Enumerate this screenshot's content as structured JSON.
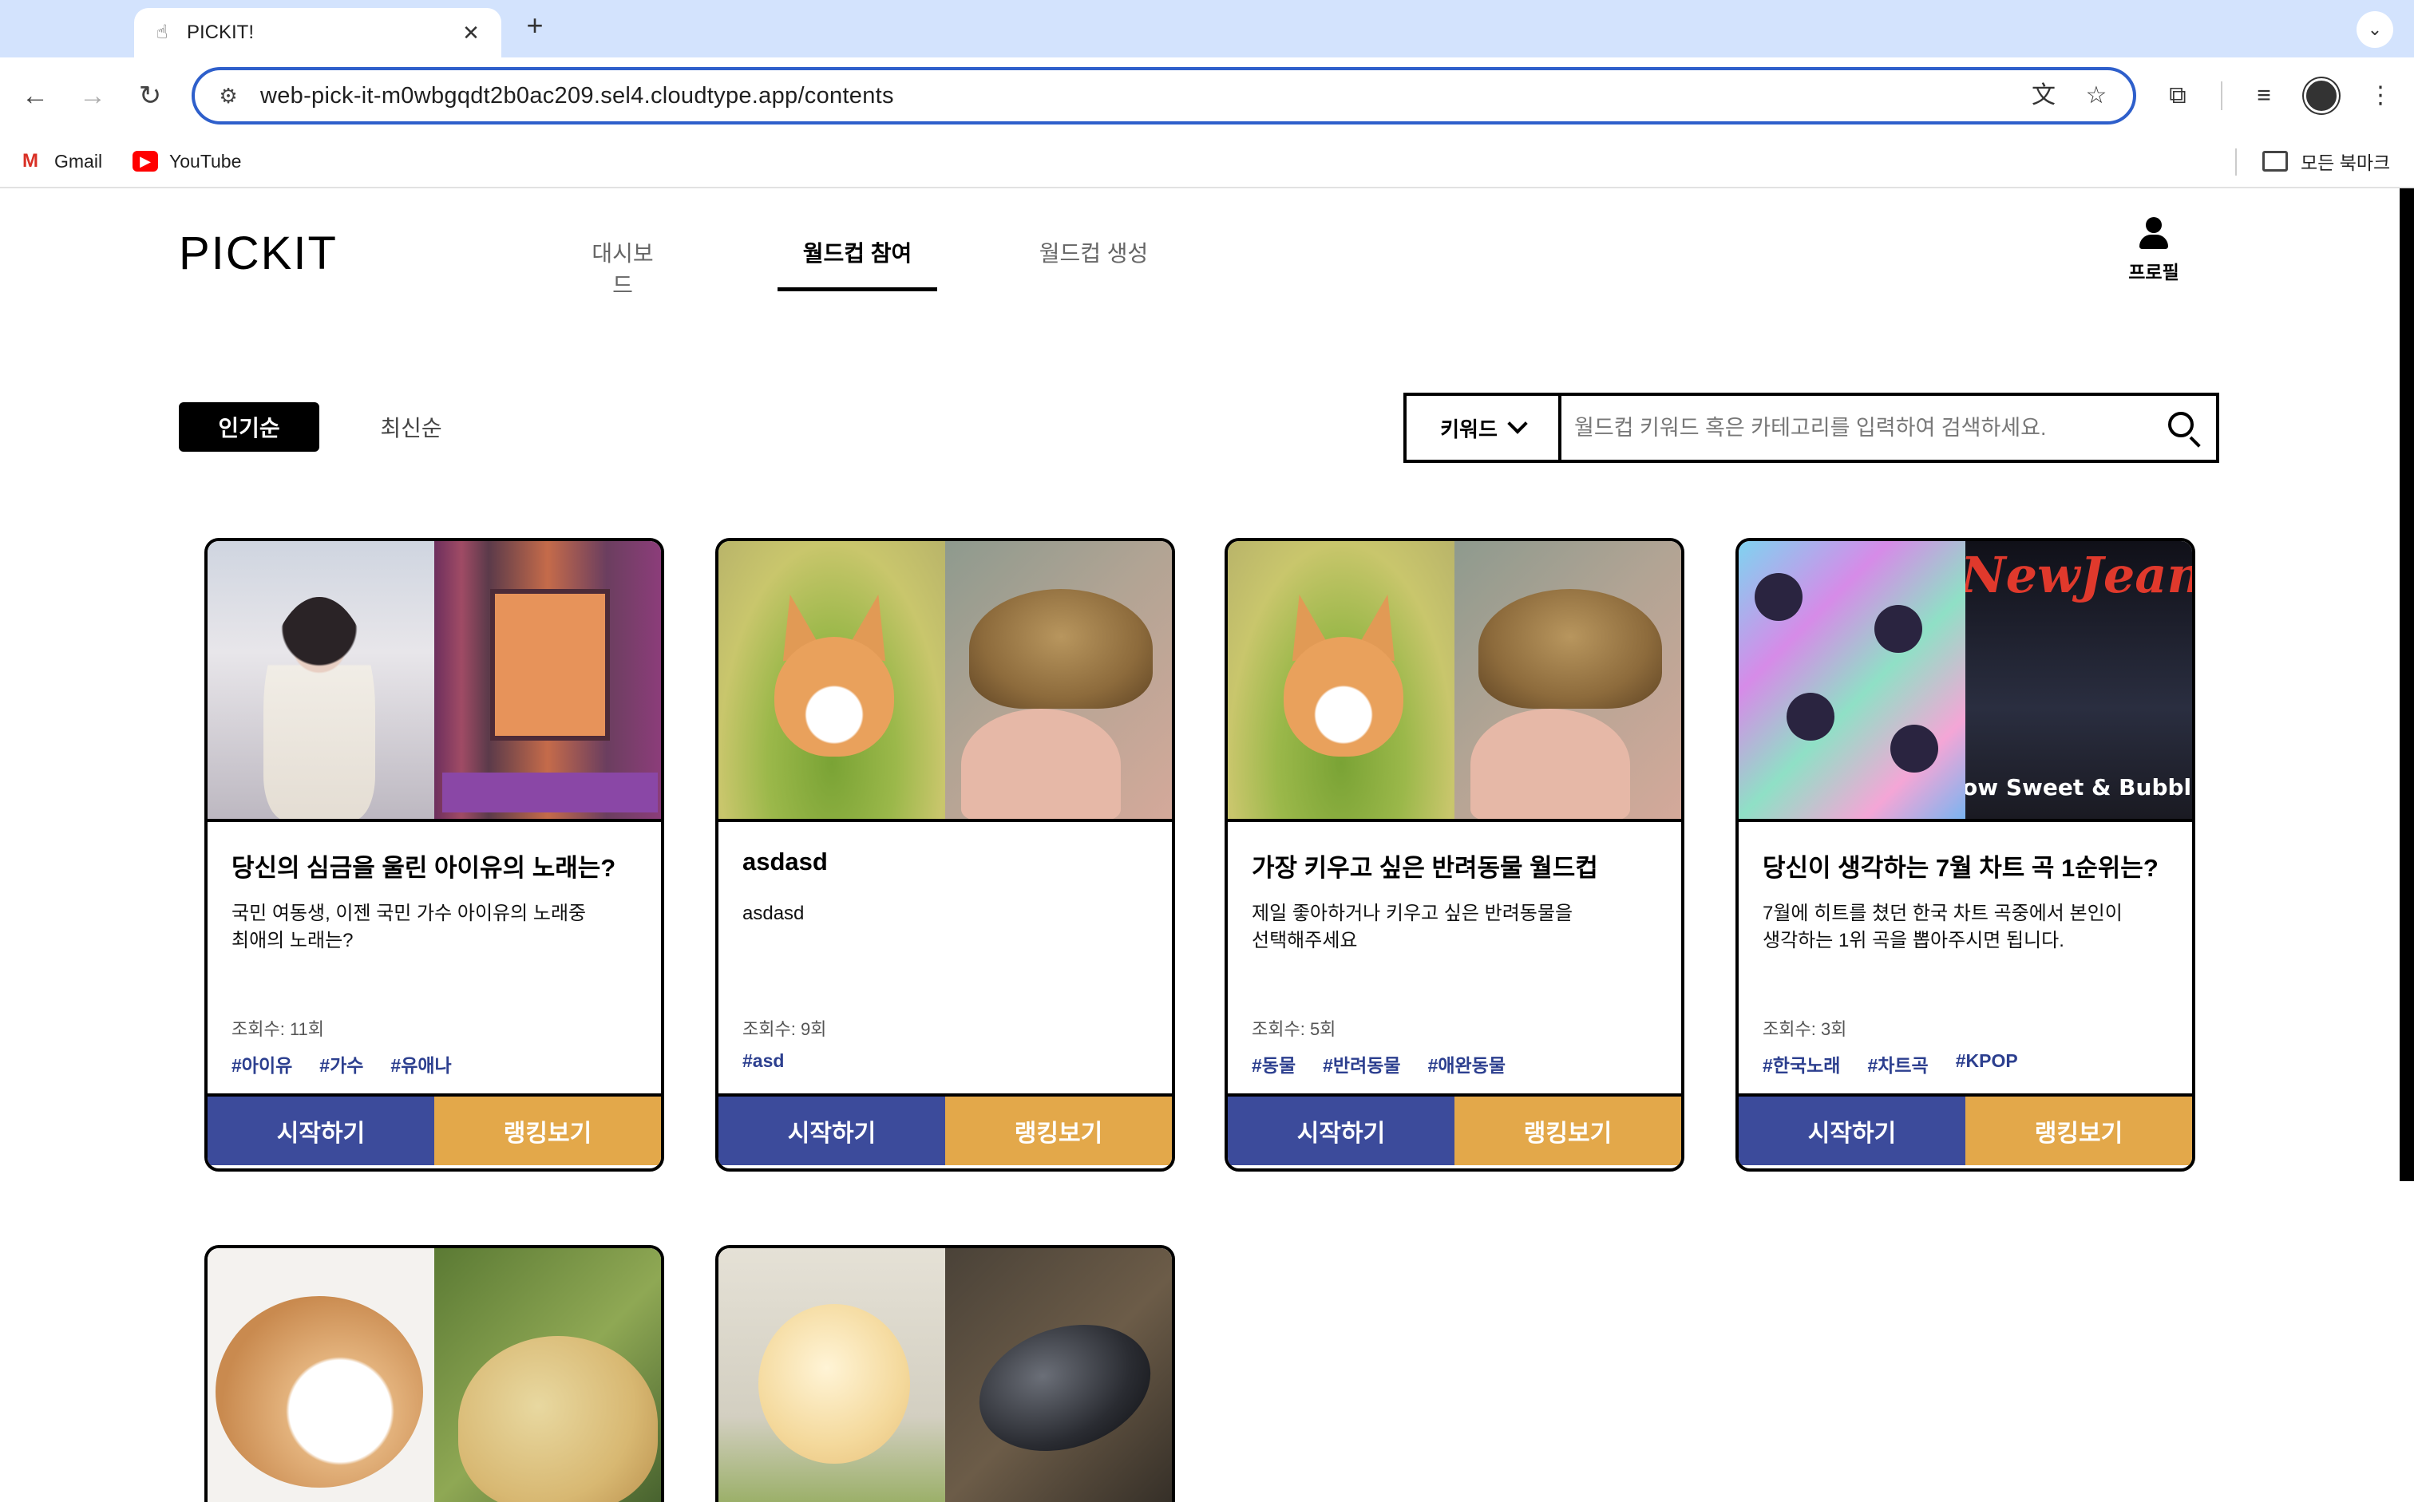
{
  "browser": {
    "tab_title": "PICKIT!",
    "url": "web-pick-it-m0wbgqdt2b0ac209.sel4.cloudtype.app/contents",
    "bookmarks": [
      "Gmail",
      "YouTube"
    ],
    "all_bookmarks": "모든 북마크"
  },
  "header": {
    "logo": "PICKIT",
    "nav": [
      "대시보드",
      "월드컵 참여",
      "월드컵 생성"
    ],
    "active_nav": "월드컵 참여",
    "profile_label": "프로필"
  },
  "sort": {
    "popular": "인기순",
    "latest": "최신순"
  },
  "search": {
    "filter": "키워드",
    "placeholder": "월드컵 키워드 혹은 카테고리를 입력하여 검색하세요."
  },
  "cards": [
    {
      "title": "당신의 심금을 울린 아이유의 노래는?",
      "description": "국민 여동생, 이젠 국민 가수 아이유의 노래중\n최애의 노래는?",
      "views": "조회수: 11회",
      "tags": [
        "#아이유",
        "#가수",
        "#유애나"
      ],
      "start": "시작하기",
      "ranking": "랭킹보기"
    },
    {
      "title": "asdasd",
      "description": "asdasd",
      "views": "조회수: 9회",
      "tags": [
        "#asd"
      ],
      "start": "시작하기",
      "ranking": "랭킹보기"
    },
    {
      "title": "가장 키우고 싶은 반려동물 월드컵",
      "description": "제일 좋아하거나 키우고 싶은 반려동물을\n선택해주세요",
      "views": "조회수: 5회",
      "tags": [
        "#동물",
        "#반려동물",
        "#애완동물"
      ],
      "start": "시작하기",
      "ranking": "랭킹보기"
    },
    {
      "title": "당신이 생각하는 7월 차트 곡 1순위는?",
      "description": "7월에 히트를 쳤던 한국 차트 곡중에서 본인이\n생각하는 1위 곡을 뽑아주시면 됩니다.",
      "views": "조회수: 3회",
      "tags": [
        "#한국노래",
        "#차트곡",
        "#KPOP"
      ],
      "start": "시작하기",
      "ranking": "랭킹보기",
      "image_text": [
        "NewJeans",
        "ow Sweet & Bubble Gu"
      ]
    }
  ],
  "colors": {
    "start_button": "#3c4b9b",
    "ranking_button": "#e3a84a",
    "tag": "#2c3f8f",
    "omnibox_border": "#2e5fcb"
  }
}
